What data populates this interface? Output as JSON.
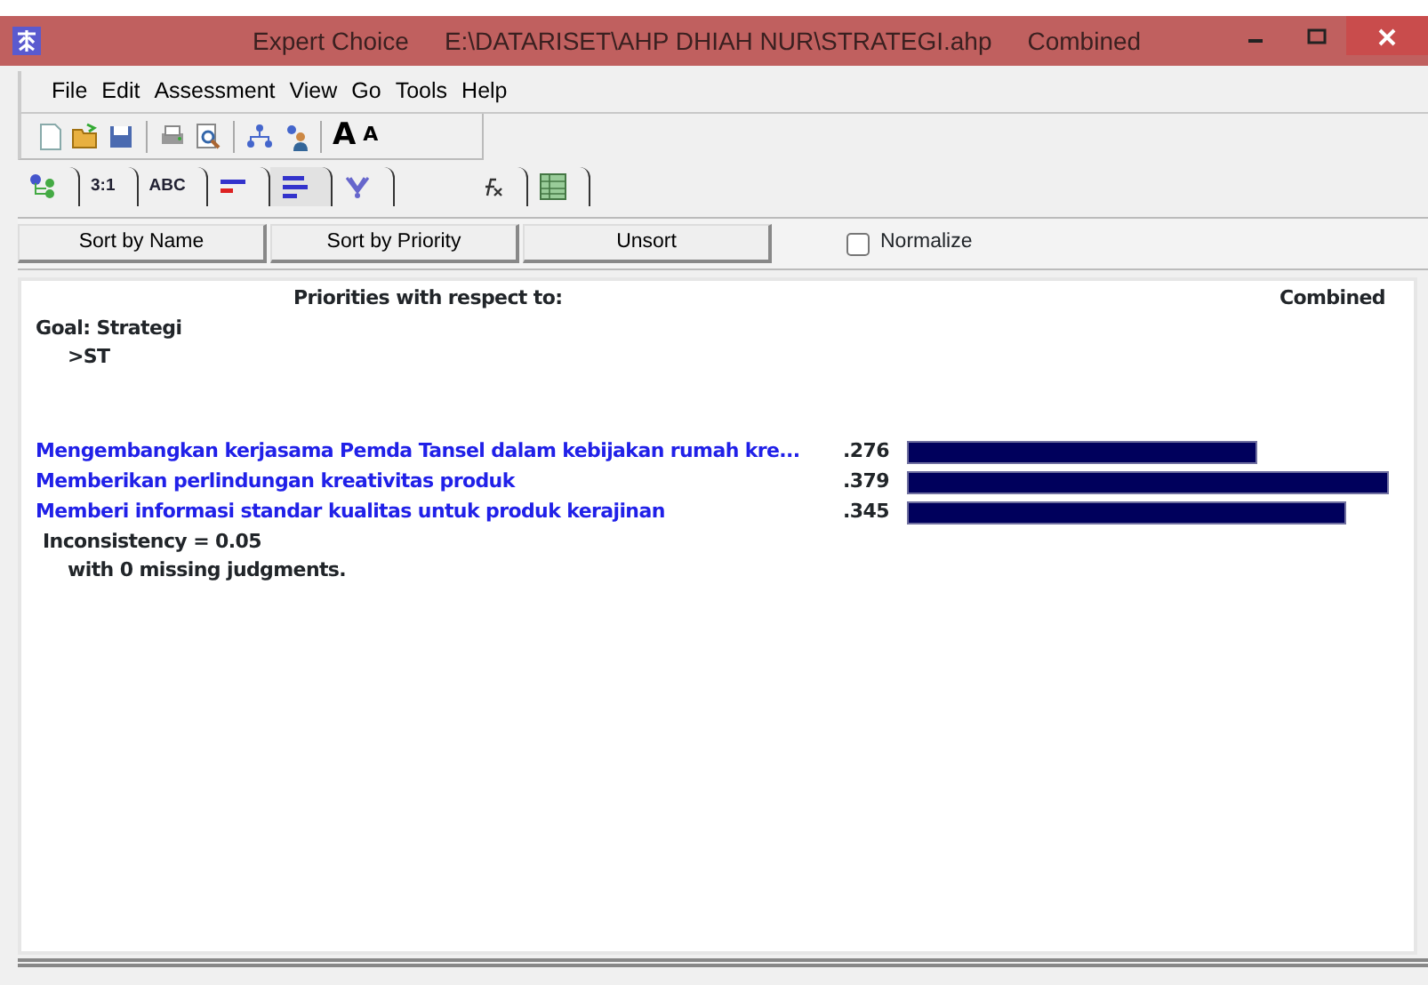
{
  "window": {
    "title_parts": [
      "Expert Choice",
      "E:\\DATARISET\\AHP DHIAH NUR\\STRATEGI.ahp",
      "Combined"
    ]
  },
  "menu": [
    "File",
    "Edit",
    "Assessment",
    "View",
    "Go",
    "Tools",
    "Help"
  ],
  "toolbar": [
    {
      "kind": "new"
    },
    {
      "kind": "open"
    },
    {
      "kind": "save"
    },
    {
      "kind": "sep"
    },
    {
      "kind": "print"
    },
    {
      "kind": "preview"
    },
    {
      "kind": "sep"
    },
    {
      "kind": "tree"
    },
    {
      "kind": "users"
    },
    {
      "kind": "sep"
    },
    {
      "kind": "font-up",
      "label": "A"
    },
    {
      "kind": "font-down",
      "label": "A"
    }
  ],
  "tabs": [
    {
      "kind": "tree",
      "selected": false
    },
    {
      "kind": "text",
      "label": "3:1",
      "selected": false
    },
    {
      "kind": "text",
      "label": "ABC",
      "selected": false
    },
    {
      "kind": "bars-red",
      "selected": false
    },
    {
      "kind": "bars",
      "selected": true
    },
    {
      "kind": "sens",
      "selected": false
    },
    {
      "kind": "gap"
    },
    {
      "kind": "fx",
      "selected": false
    },
    {
      "kind": "grid",
      "selected": false
    }
  ],
  "buttons": [
    "Sort by Name",
    "Sort by Priority",
    "Unsort"
  ],
  "normalize": {
    "label": "Normalize",
    "checked": false
  },
  "report": {
    "heading": "Priorities with respect to:",
    "mode": "Combined",
    "goal": "Goal: Strategi",
    "node": ">ST",
    "rows": [
      {
        "label": "Mengembangkan kerjasama Pemda Tansel dalam kebijakan rumah kre...",
        "value": ".276",
        "level": 0.728
      },
      {
        "label": "Memberikan perlindungan kreativitas produk",
        "value": ".379",
        "level": 1.0
      },
      {
        "label": "Memberi informasi standar kualitas untuk produk kerajinan",
        "value": ".345",
        "level": 0.91
      }
    ],
    "inconsistency": "Inconsistency = 0.05",
    "missing": "with 0  missing judgments."
  }
}
